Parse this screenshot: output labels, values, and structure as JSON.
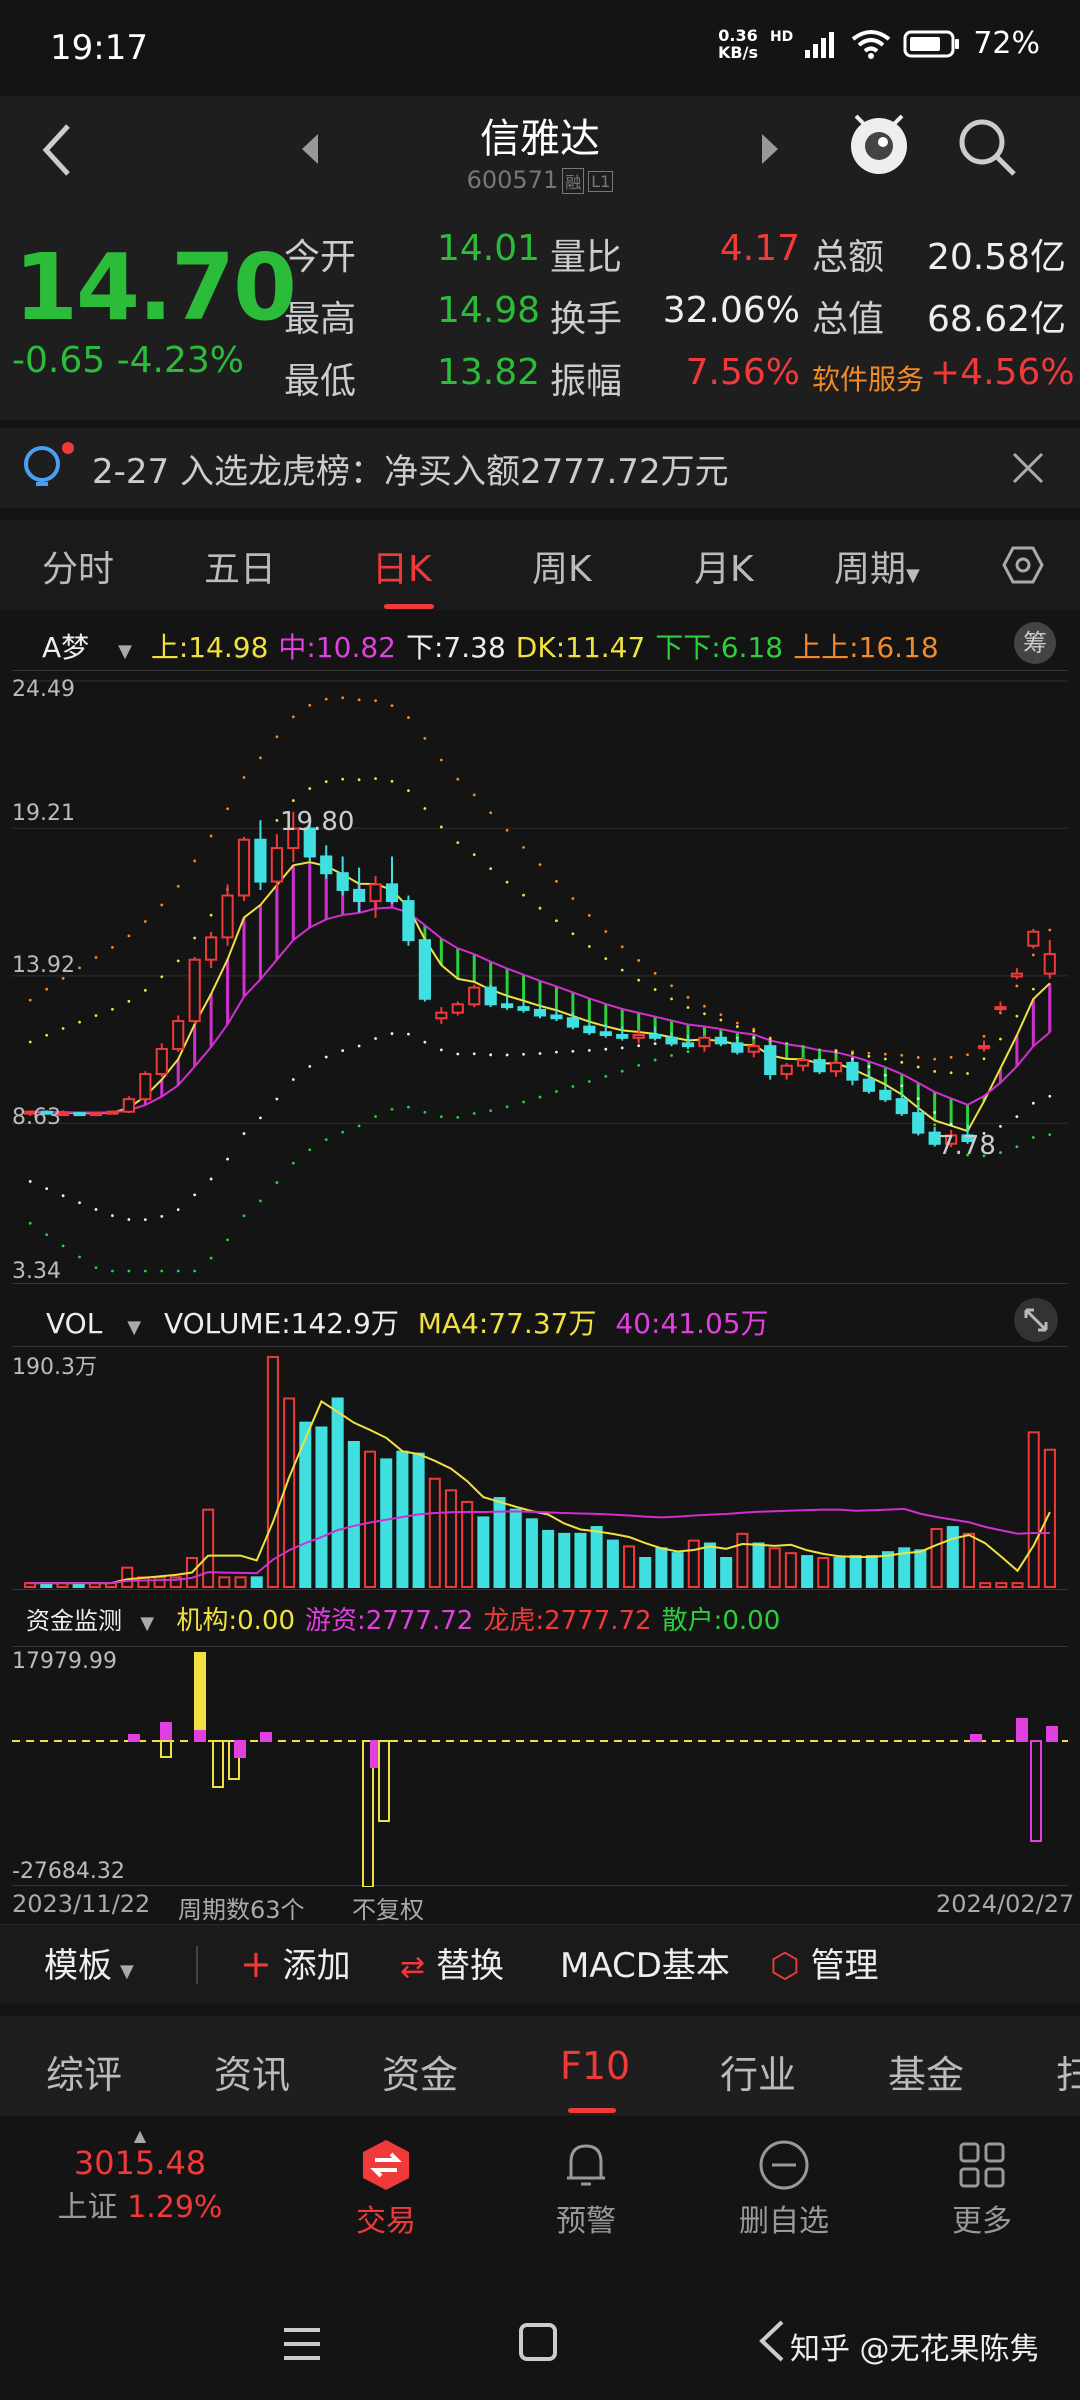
{
  "status": {
    "time": "19:17",
    "net_top": "0.36",
    "net_bottom": "KB/s",
    "hd": "HD",
    "battery": "72%"
  },
  "header": {
    "title": "信雅达",
    "code": "600571",
    "tag1": "融",
    "tag2": "L1"
  },
  "quote": {
    "price": "14.70",
    "change": "-0.65",
    "change_pct": "-4.23%",
    "rows": [
      {
        "l1": "今开",
        "v1": "14.01",
        "l2": "量比",
        "v2": "4.17",
        "l3": "总额",
        "v3": "20.58亿"
      },
      {
        "l1": "最高",
        "v1": "14.98",
        "l2": "换手",
        "v2": "32.06%",
        "l3": "总值",
        "v3": "68.62亿"
      },
      {
        "l1": "最低",
        "v1": "13.82",
        "l2": "振幅",
        "v2": "7.56%",
        "l3": "软件服务",
        "v3": "+4.56%"
      }
    ]
  },
  "notice": {
    "text": "2-27 入选龙虎榜：净买入额2777.72万元"
  },
  "period_tabs": [
    "分时",
    "五日",
    "日K",
    "周K",
    "月K",
    "周期"
  ],
  "active_tab": "日K",
  "main_indicator": {
    "name": "A梦",
    "items": [
      {
        "k": "上:",
        "v": "14.98",
        "color": "#f0e040"
      },
      {
        "k": "中:",
        "v": "10.82",
        "color": "#e040e0"
      },
      {
        "k": "下:",
        "v": "7.38",
        "color": "#eeeeee"
      },
      {
        "k": "DK:",
        "v": "11.47",
        "color": "#f0e040"
      },
      {
        "k": "下下:",
        "v": "6.18",
        "color": "#2bd03a"
      },
      {
        "k": "上上:",
        "v": "16.18",
        "color": "#f08a2a"
      }
    ],
    "chip": "筹"
  },
  "kline": {
    "y_labels": [
      "24.49",
      "19.21",
      "13.92",
      "8.63",
      "3.34"
    ],
    "high_label": "19.80",
    "low_label": "7.78"
  },
  "vol_indicator": {
    "name": "VOL",
    "volume_label": "VOLUME:",
    "volume_value": "142.9万",
    "ma4_label": "MA4:",
    "ma4_value": "77.37万",
    "ma40_label": "40:",
    "ma40_value": "41.05万",
    "y_max": "190.3万"
  },
  "fund_indicator": {
    "name": "资金监测",
    "items": [
      {
        "k": "机构:",
        "v": "0.00",
        "color": "#f0e040"
      },
      {
        "k": "游资:",
        "v": "2777.72",
        "color": "#e040e0"
      },
      {
        "k": "龙虎:",
        "v": "2777.72",
        "color": "#f03a3a"
      },
      {
        "k": "散户:",
        "v": "0.00",
        "color": "#2bd03a"
      }
    ],
    "y_max": "17979.99",
    "y_min": "-27684.32"
  },
  "chart_footer": {
    "start": "2023/11/22",
    "period_count": "周期数63个",
    "adjust": "不复权",
    "end": "2024/02/27"
  },
  "toolbar": {
    "template": "模板",
    "add": "添加",
    "replace": "替换",
    "macd": "MACD基本",
    "manage": "管理"
  },
  "f10_tabs": [
    "综评",
    "资讯",
    "资金",
    "F10",
    "行业",
    "基金",
    "扫"
  ],
  "active_f10": "F10",
  "bottom_nav": {
    "index_value": "3015.48",
    "index_name": "上证",
    "index_pct": "1.29%",
    "items": [
      "交易",
      "预警",
      "删自选",
      "更多"
    ]
  },
  "watermark": "知乎 @无花果陈隽",
  "chart_data": {
    "type": "candlestick",
    "ylim": [
      3.34,
      24.49
    ],
    "candles": [
      [
        9.0,
        9.1,
        8.9,
        9.05
      ],
      [
        9.05,
        9.1,
        8.95,
        9.0
      ],
      [
        9.0,
        9.1,
        8.9,
        9.0
      ],
      [
        9.0,
        9.05,
        8.9,
        8.95
      ],
      [
        8.95,
        9.05,
        8.9,
        9.0
      ],
      [
        9.0,
        9.1,
        8.95,
        9.05
      ],
      [
        9.05,
        9.6,
        9.0,
        9.5
      ],
      [
        9.5,
        10.5,
        9.4,
        10.4
      ],
      [
        10.4,
        11.5,
        10.3,
        11.3
      ],
      [
        11.3,
        12.5,
        11.2,
        12.3
      ],
      [
        12.3,
        14.6,
        12.2,
        14.5
      ],
      [
        14.5,
        15.5,
        14.2,
        15.3
      ],
      [
        15.3,
        17.2,
        15.0,
        16.8
      ],
      [
        16.8,
        18.9,
        16.6,
        18.8
      ],
      [
        18.8,
        19.5,
        17.0,
        17.3
      ],
      [
        17.3,
        19.0,
        17.0,
        18.5
      ],
      [
        18.5,
        19.8,
        18.0,
        19.2
      ],
      [
        19.2,
        19.6,
        18.0,
        18.2
      ],
      [
        18.2,
        18.6,
        17.4,
        17.6
      ],
      [
        17.6,
        18.2,
        16.8,
        17.0
      ],
      [
        17.0,
        17.8,
        16.2,
        16.6
      ],
      [
        16.6,
        17.5,
        16.0,
        17.2
      ],
      [
        17.2,
        18.2,
        16.5,
        16.6
      ],
      [
        16.6,
        16.8,
        15.0,
        15.2
      ],
      [
        15.2,
        14.8,
        13.0,
        13.1
      ],
      [
        12.4,
        12.8,
        12.2,
        12.6
      ],
      [
        12.6,
        13.0,
        12.5,
        12.9
      ],
      [
        12.9,
        13.6,
        12.8,
        13.5
      ],
      [
        13.5,
        13.6,
        12.8,
        12.9
      ],
      [
        12.9,
        13.2,
        12.7,
        12.8
      ],
      [
        12.8,
        13.0,
        12.6,
        12.7
      ],
      [
        12.7,
        12.9,
        12.4,
        12.5
      ],
      [
        12.5,
        12.7,
        12.3,
        12.4
      ],
      [
        12.4,
        12.6,
        12.0,
        12.1
      ],
      [
        12.1,
        12.3,
        11.8,
        11.9
      ],
      [
        11.9,
        12.2,
        11.7,
        11.8
      ],
      [
        11.8,
        12.1,
        11.6,
        11.7
      ],
      [
        11.7,
        12.0,
        11.5,
        11.8
      ],
      [
        11.8,
        12.1,
        11.6,
        11.7
      ],
      [
        11.7,
        11.9,
        11.4,
        11.5
      ],
      [
        11.5,
        11.8,
        11.3,
        11.4
      ],
      [
        11.4,
        11.8,
        11.2,
        11.7
      ],
      [
        11.7,
        11.9,
        11.4,
        11.5
      ],
      [
        11.5,
        11.7,
        11.1,
        11.2
      ],
      [
        11.2,
        11.6,
        11.0,
        11.4
      ],
      [
        11.4,
        11.5,
        10.2,
        10.4
      ],
      [
        10.4,
        10.8,
        10.2,
        10.7
      ],
      [
        10.7,
        11.0,
        10.5,
        10.9
      ],
      [
        10.9,
        11.0,
        10.4,
        10.5
      ],
      [
        10.5,
        10.9,
        10.3,
        10.8
      ],
      [
        10.8,
        10.9,
        10.0,
        10.2
      ],
      [
        10.2,
        10.5,
        9.7,
        9.8
      ],
      [
        9.8,
        10.0,
        9.4,
        9.5
      ],
      [
        9.5,
        9.8,
        8.9,
        9.0
      ],
      [
        9.0,
        9.3,
        8.2,
        8.3
      ],
      [
        8.3,
        8.5,
        7.8,
        7.9
      ],
      [
        7.9,
        8.4,
        7.78,
        8.2
      ],
      [
        8.2,
        8.6,
        7.9,
        8.0
      ],
      [
        11.4,
        11.6,
        11.2,
        11.4
      ],
      [
        12.8,
        13.0,
        12.6,
        12.8
      ],
      [
        13.9,
        14.2,
        13.8,
        14.0
      ],
      [
        15.0,
        15.6,
        14.9,
        15.5
      ],
      [
        14.0,
        15.2,
        13.82,
        14.7
      ]
    ]
  }
}
